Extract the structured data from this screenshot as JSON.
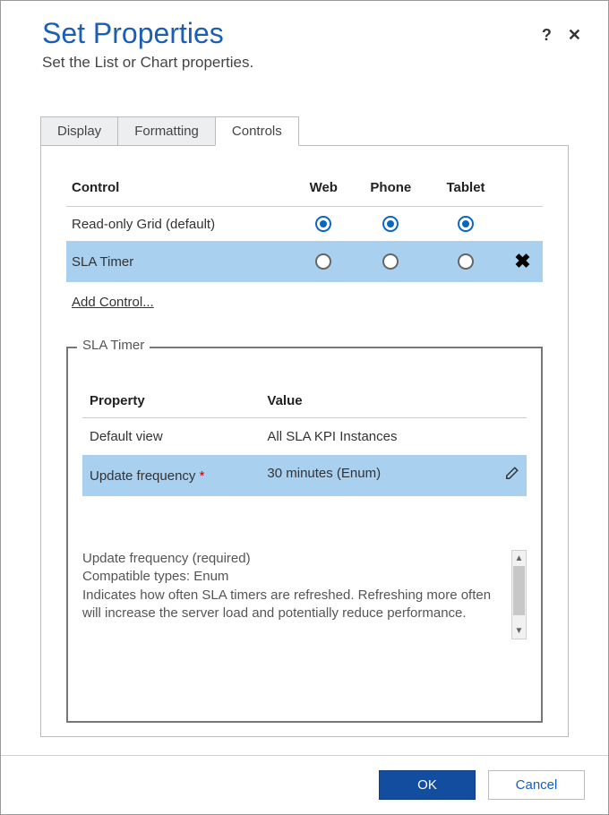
{
  "header": {
    "title": "Set Properties",
    "subtitle": "Set the List or Chart properties."
  },
  "tabs": {
    "display": "Display",
    "formatting": "Formatting",
    "controls": "Controls"
  },
  "controlTable": {
    "headers": {
      "control": "Control",
      "web": "Web",
      "phone": "Phone",
      "tablet": "Tablet"
    },
    "rows": [
      {
        "name": "Read-only Grid (default)"
      },
      {
        "name": "SLA Timer"
      }
    ]
  },
  "addControl": "Add Control...",
  "fieldset": {
    "legend": "SLA Timer",
    "headers": {
      "property": "Property",
      "value": "Value"
    },
    "rows": [
      {
        "property": "Default view",
        "value": "All SLA KPI Instances"
      },
      {
        "property": "Update frequency",
        "value": "30 minutes (Enum)"
      }
    ],
    "desc": {
      "line1": "Update frequency (required)",
      "line2": "Compatible types: Enum",
      "line3": "Indicates how often SLA timers are refreshed. Refreshing more often will increase the server load and potentially reduce performance."
    }
  },
  "footer": {
    "ok": "OK",
    "cancel": "Cancel"
  }
}
